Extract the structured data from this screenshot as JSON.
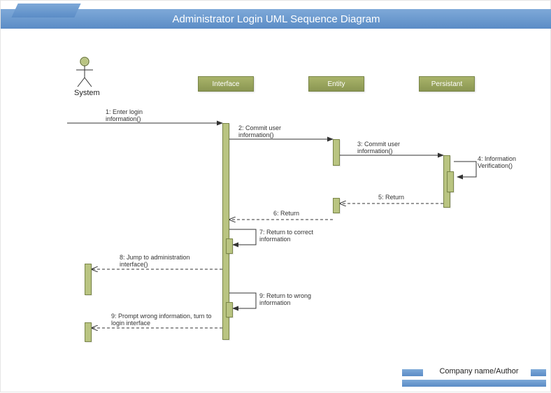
{
  "title": "Administrator Login UML Sequence Diagram",
  "actor": {
    "label": "System"
  },
  "participants": {
    "interface": "Interface",
    "entity": "Entity",
    "persistant": "Persistant"
  },
  "messages": {
    "m1": "1: Enter login information()",
    "m2": "2: Commit user information()",
    "m3": "3: Commit user information()",
    "m4": "4: Information Verification()",
    "m5": "5: Return",
    "m6": "6: Return",
    "m7": "7: Return to correct information",
    "m8": "8: Jump to administration interface()",
    "m9a": "9: Return to wrong information",
    "m9b": "9: Prompt wrong information, turn to login interface"
  },
  "footer": {
    "text": "Company name/Author"
  },
  "chart_data": {
    "type": "uml-sequence",
    "title": "Administrator Login UML Sequence Diagram",
    "participants": [
      "System",
      "Interface",
      "Entity",
      "Persistant"
    ],
    "messages": [
      {
        "n": 1,
        "from": "System",
        "to": "Interface",
        "label": "Enter login information()",
        "style": "solid"
      },
      {
        "n": 2,
        "from": "Interface",
        "to": "Entity",
        "label": "Commit user information()",
        "style": "solid"
      },
      {
        "n": 3,
        "from": "Entity",
        "to": "Persistant",
        "label": "Commit user information()",
        "style": "solid"
      },
      {
        "n": 4,
        "from": "Persistant",
        "to": "Persistant",
        "label": "Information Verification()",
        "style": "solid-self"
      },
      {
        "n": 5,
        "from": "Persistant",
        "to": "Entity",
        "label": "Return",
        "style": "dashed"
      },
      {
        "n": 6,
        "from": "Entity",
        "to": "Interface",
        "label": "Return",
        "style": "dashed"
      },
      {
        "n": 7,
        "from": "Interface",
        "to": "Interface",
        "label": "Return to correct information",
        "style": "solid-self"
      },
      {
        "n": 8,
        "from": "Interface",
        "to": "System",
        "label": "Jump to administration interface()",
        "style": "dashed"
      },
      {
        "n": 9,
        "from": "Interface",
        "to": "Interface",
        "label": "Return to wrong information",
        "style": "solid-self"
      },
      {
        "n": 9,
        "from": "Interface",
        "to": "System",
        "label": "Prompt wrong information, turn to login interface",
        "style": "dashed"
      }
    ]
  }
}
